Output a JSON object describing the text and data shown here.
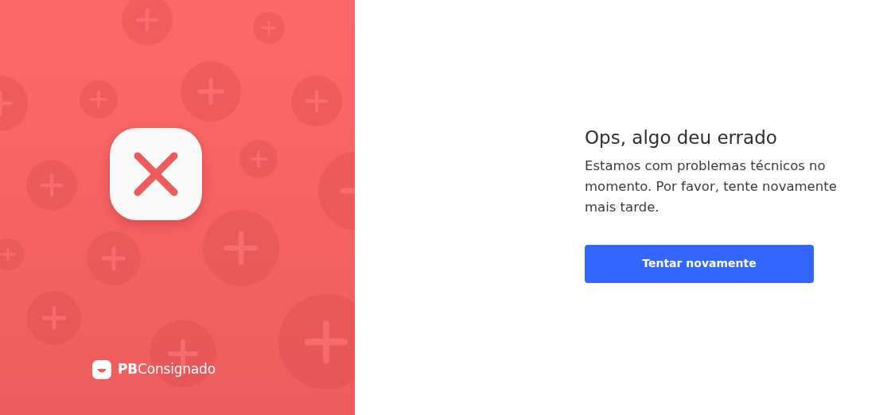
{
  "brand": {
    "name": "**PB**Consignado"
  },
  "error": {
    "title": "Ops, algo deu errado",
    "message": "Estamos com problemas técnicos no momento. Por favor, tente novamente mais tarde.",
    "button": "Tentar novamente"
  }
}
